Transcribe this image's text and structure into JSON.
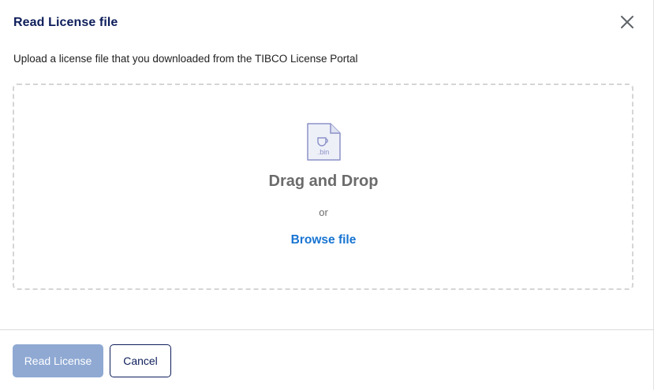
{
  "dialog": {
    "title": "Read License file",
    "subtitle": "Upload a license file that you downloaded from the TIBCO License Portal",
    "close_icon": "close-icon"
  },
  "dropzone": {
    "icon": "bin-file-icon",
    "icon_ext": ".bin",
    "title": "Drag and Drop",
    "or_text": "or",
    "browse_label": "Browse file"
  },
  "footer": {
    "primary_label": "Read License",
    "primary_enabled": false,
    "secondary_label": "Cancel"
  },
  "colors": {
    "title": "#0e1e5b",
    "link": "#1774d2",
    "primary_disabled": "#8fa9d3",
    "dashed_border": "#d5d5d5"
  }
}
